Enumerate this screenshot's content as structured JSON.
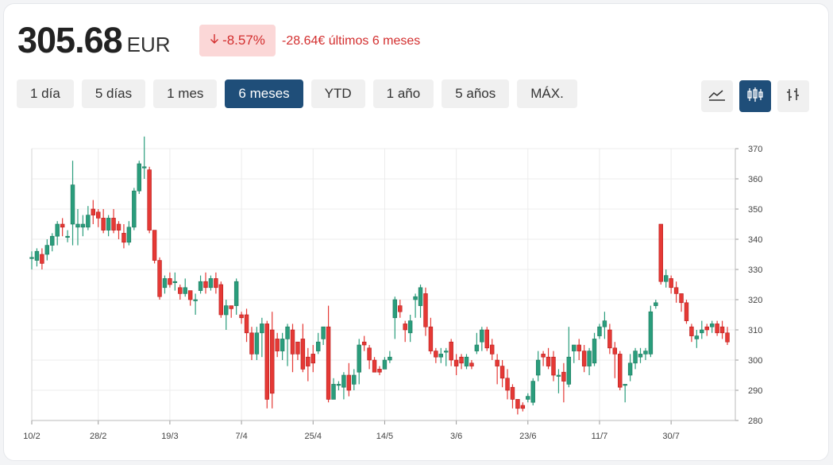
{
  "quote": {
    "price": "305.68",
    "currency": "EUR",
    "change_pct": "-8.57%",
    "change_abs": "-28.64€ últimos 6 meses",
    "arrow_icon": "arrow-down-icon"
  },
  "ranges": [
    "1 día",
    "5 días",
    "1 mes",
    "6 meses",
    "YTD",
    "1 año",
    "5 años",
    "MÁX."
  ],
  "active_range": "6 meses",
  "chart_types": [
    {
      "name": "line-chart-icon",
      "active": false
    },
    {
      "name": "candlestick-chart-icon",
      "active": true
    },
    {
      "name": "ohlc-chart-icon",
      "active": false
    }
  ],
  "colors": {
    "up": "#2a9d7c",
    "down": "#e53935",
    "accent": "#1f4e79"
  },
  "chart_data": {
    "type": "candlestick",
    "ylim": [
      280,
      370
    ],
    "yticks": [
      280,
      290,
      300,
      310,
      320,
      330,
      340,
      350,
      360,
      370
    ],
    "xticks": [
      "10/2",
      "28/2",
      "19/3",
      "7/4",
      "25/4",
      "14/5",
      "3/6",
      "23/6",
      "11/7",
      "30/7"
    ],
    "candles": [
      [
        334,
        334,
        336,
        330
      ],
      [
        333,
        336,
        337,
        331
      ],
      [
        335,
        332,
        337,
        330
      ],
      [
        335,
        338,
        340,
        333
      ],
      [
        338,
        341,
        342,
        336
      ],
      [
        341,
        345,
        346,
        338
      ],
      [
        345,
        344,
        347,
        341
      ],
      [
        341,
        341,
        343,
        339
      ],
      [
        345,
        358,
        366,
        338
      ],
      [
        344,
        345,
        350,
        338
      ],
      [
        344,
        345,
        348,
        341
      ],
      [
        344,
        348,
        351,
        343
      ],
      [
        350,
        348,
        353,
        345
      ],
      [
        349,
        347,
        350,
        344
      ],
      [
        347,
        343,
        350,
        342
      ],
      [
        343,
        347,
        348,
        341
      ],
      [
        347,
        343,
        350,
        342
      ],
      [
        345,
        343,
        346,
        340
      ],
      [
        342,
        339,
        345,
        337
      ],
      [
        339,
        344,
        346,
        338
      ],
      [
        344,
        356,
        357,
        343
      ],
      [
        356,
        365,
        366,
        355
      ],
      [
        364,
        364,
        374,
        360
      ],
      [
        363,
        343,
        364,
        342
      ],
      [
        343,
        333,
        343,
        332
      ],
      [
        333,
        321,
        334,
        320
      ],
      [
        324,
        327,
        328,
        322
      ],
      [
        327,
        325,
        329,
        324
      ],
      [
        326,
        326,
        329,
        323
      ],
      [
        324,
        322,
        325,
        320
      ],
      [
        322,
        324,
        327,
        321
      ],
      [
        323,
        320,
        323,
        318
      ],
      [
        320,
        320,
        322,
        315
      ],
      [
        323,
        326,
        328,
        322
      ],
      [
        326,
        324,
        329,
        322
      ],
      [
        324,
        327,
        328,
        323
      ],
      [
        327,
        324,
        329,
        322
      ],
      [
        325,
        315,
        326,
        314
      ],
      [
        315,
        318,
        320,
        310
      ],
      [
        318,
        317,
        318,
        314
      ],
      [
        318,
        326,
        327,
        315
      ],
      [
        315,
        314,
        316,
        312
      ],
      [
        315,
        309,
        317,
        306
      ],
      [
        309,
        302,
        311,
        300
      ],
      [
        302,
        309,
        311,
        300
      ],
      [
        309,
        312,
        314,
        301
      ],
      [
        312,
        287,
        313,
        284
      ],
      [
        310,
        289,
        316,
        284
      ],
      [
        307,
        303,
        309,
        301
      ],
      [
        303,
        307,
        309,
        300
      ],
      [
        307,
        311,
        312,
        298
      ],
      [
        310,
        302,
        312,
        296
      ],
      [
        306,
        302,
        304,
        300
      ],
      [
        307,
        297,
        312,
        296
      ],
      [
        301,
        298,
        304,
        293
      ],
      [
        302,
        299,
        305,
        296
      ],
      [
        303,
        306,
        309,
        302
      ],
      [
        307,
        311,
        311,
        305
      ],
      [
        311,
        287,
        318,
        286
      ],
      [
        287,
        292,
        294,
        289
      ],
      [
        292,
        292,
        293,
        290
      ],
      [
        291,
        295,
        296,
        287
      ],
      [
        295,
        290,
        299,
        288
      ],
      [
        292,
        295,
        297,
        290
      ],
      [
        296,
        305,
        307,
        292
      ],
      [
        306,
        305,
        308,
        303
      ],
      [
        304,
        300,
        305,
        297
      ],
      [
        300,
        296,
        301,
        296
      ],
      [
        297,
        296,
        298,
        295
      ],
      [
        297,
        300,
        301,
        297
      ],
      [
        300,
        301,
        303,
        299
      ],
      [
        314,
        320,
        321,
        307
      ],
      [
        318,
        316,
        320,
        314
      ],
      [
        312,
        310,
        313,
        306
      ],
      [
        309,
        313,
        315,
        306
      ],
      [
        320,
        321,
        322,
        314
      ],
      [
        318,
        324,
        325,
        314
      ],
      [
        322,
        311,
        324,
        308
      ],
      [
        311,
        303,
        314,
        302
      ],
      [
        303,
        301,
        304,
        299
      ],
      [
        301,
        302,
        304,
        299
      ],
      [
        303,
        303,
        304,
        298
      ],
      [
        306,
        300,
        307,
        298
      ],
      [
        300,
        298,
        302,
        295
      ],
      [
        301,
        299,
        302,
        297
      ],
      [
        298,
        301,
        302,
        297
      ],
      [
        299,
        298,
        300,
        297
      ],
      [
        303,
        305,
        309,
        302
      ],
      [
        306,
        310,
        311,
        303
      ],
      [
        310,
        304,
        311,
        303
      ],
      [
        305,
        302,
        307,
        300
      ],
      [
        300,
        298,
        302,
        292
      ],
      [
        298,
        294,
        300,
        291
      ],
      [
        294,
        290,
        297,
        287
      ],
      [
        291,
        287,
        292,
        284
      ],
      [
        287,
        284,
        287,
        282
      ],
      [
        285,
        284,
        286,
        283
      ],
      [
        287,
        288,
        289,
        286
      ],
      [
        286,
        293,
        294,
        285
      ],
      [
        295,
        300,
        303,
        293
      ],
      [
        302,
        301,
        303,
        298
      ],
      [
        301,
        298,
        304,
        297
      ],
      [
        301,
        295,
        303,
        293
      ],
      [
        295,
        295,
        297,
        289
      ],
      [
        296,
        293,
        299,
        286
      ],
      [
        292,
        301,
        311,
        291
      ],
      [
        303,
        305,
        305,
        299
      ],
      [
        305,
        303,
        307,
        300
      ],
      [
        303,
        298,
        305,
        296
      ],
      [
        298,
        303,
        304,
        295
      ],
      [
        299,
        307,
        309,
        298
      ],
      [
        308,
        311,
        312,
        307
      ],
      [
        311,
        313,
        316,
        307
      ],
      [
        310,
        304,
        312,
        302
      ],
      [
        304,
        302,
        306,
        294
      ],
      [
        302,
        291,
        303,
        290
      ],
      [
        292,
        292,
        292,
        286
      ],
      [
        295,
        299,
        302,
        293
      ],
      [
        299,
        303,
        304,
        297
      ],
      [
        301,
        302,
        304,
        299
      ],
      [
        302,
        303,
        304,
        300
      ],
      [
        302,
        316,
        318,
        301
      ],
      [
        318,
        319,
        320,
        317
      ],
      [
        345,
        326,
        345,
        325
      ],
      [
        326,
        328,
        330,
        324
      ],
      [
        327,
        324,
        328,
        322
      ],
      [
        324,
        322,
        326,
        319
      ],
      [
        322,
        319,
        322,
        316
      ],
      [
        319,
        313,
        320,
        312
      ],
      [
        311,
        308,
        312,
        306
      ],
      [
        307,
        308,
        310,
        304
      ],
      [
        309,
        310,
        313,
        307
      ],
      [
        311,
        310,
        312,
        308
      ],
      [
        311,
        312,
        313,
        309
      ],
      [
        312,
        309,
        313,
        308
      ],
      [
        311,
        309,
        313,
        307
      ],
      [
        309,
        306,
        311,
        305
      ]
    ]
  }
}
